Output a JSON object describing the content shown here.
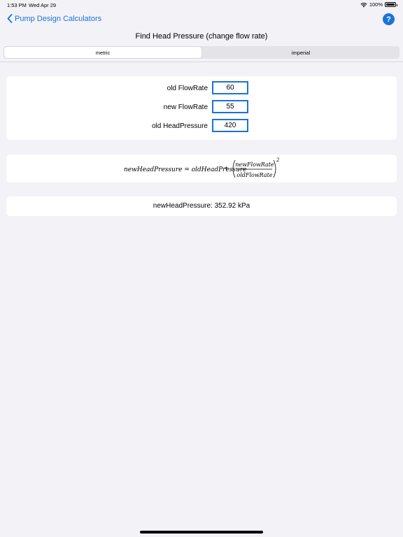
{
  "status_bar": {
    "time": "1:53 PM",
    "date": "Wed Apr 29",
    "battery": "100%"
  },
  "nav": {
    "back_label": "Pump Design Calculators",
    "help_label": "?"
  },
  "title": "Find Head Pressure (change flow rate)",
  "segments": [
    {
      "label": "metric",
      "selected": true
    },
    {
      "label": "imperial",
      "selected": false
    }
  ],
  "inputs": [
    {
      "label": "old FlowRate",
      "value": "60"
    },
    {
      "label": "new FlowRate",
      "value": "55"
    },
    {
      "label": "old HeadPressure",
      "value": "420"
    }
  ],
  "formula": {
    "lhs": "newHeadPressure = oldHeadPressure",
    "operator": "*",
    "numerator": "newFlowRate",
    "denominator": "oldFlowRate",
    "exponent": "2"
  },
  "result": {
    "label": "newHeadPressure:",
    "value": "352.92 kPa"
  },
  "colors": {
    "accent": "#1a73d9",
    "background": "#f2f2f7"
  }
}
